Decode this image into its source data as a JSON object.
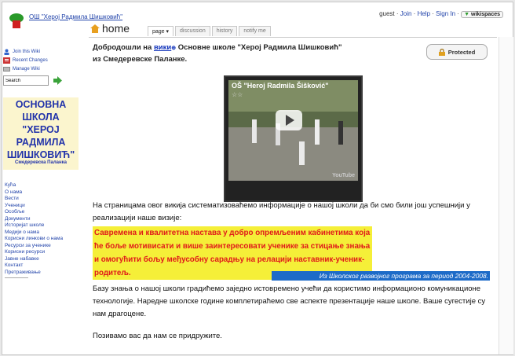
{
  "header": {
    "wiki_title": "ОШ \"Херој Радмила Шишковић\"",
    "user": "guest",
    "sep": " · ",
    "join": "Join",
    "help": "Help",
    "sign_in": "Sign In",
    "wikispaces": "wikispaces"
  },
  "page": {
    "title": "home",
    "tabs": [
      "page ▾",
      "discussion",
      "history",
      "notify me"
    ]
  },
  "sidebar": {
    "tools": [
      "Join this Wiki",
      "Recent Changes",
      "Manage Wiki"
    ],
    "search_value": "Search",
    "logo_line1": "ОСНОВНА",
    "logo_line2": "ШКОЛА",
    "logo_line3": "\"ХЕРОЈ",
    "logo_line4": "РАДМИЛА",
    "logo_line5": "ШИШКОВИЋ\"",
    "logo_sub": "Смедеревска Паланка",
    "nav": [
      "Кућа",
      "О нама",
      "Вести",
      "Ученици",
      "Особље",
      "Документи",
      "Историјат школе",
      "Медији о нама",
      "Корисни линкови о нама",
      "Ресурси за ученике",
      "Корисни ресурси",
      "Јавне набавке",
      "Контакт",
      "Претраживање"
    ]
  },
  "main": {
    "welcome_pre": "Добродошли на ",
    "welcome_link": "вики",
    "welcome_post": " Основне школе \"Херој Радмила Шишковић\" из Смедеревске Паланке.",
    "protected": "Protected",
    "video_title": "OŠ \"Heroj Radmila Šišković\"",
    "video_stars": "☆☆",
    "video_brand": "YouTube",
    "para1": "На страницама овог викија систематизоваћемо информације о нашој школи да би смо били још успешнији у реализацији наше визије:",
    "highlight": "Савремена и квалитетна настава у добро опремљеним кабинетима која ће боље мотивисати и више заинтересовати ученике за стицање знања и омогућити бољу међусобну сарадњу на релацији наставник-ученик-родитељ.",
    "caption": "Из Школског развојног програма за период 2004-2008.",
    "para2": "Базу знања о нашој школи градићемо заједно истовремено учећи да користимо информационо комуникационе технологије. Наредне школске године комплетираћемо све аспекте презентације наше школе. Ваше сугестије су нам драгоцене.",
    "para3": "Позивамо вас да нам се придружите."
  }
}
